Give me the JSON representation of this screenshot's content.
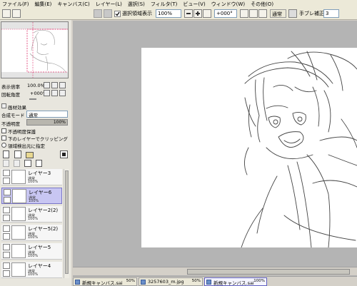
{
  "menu": [
    "ファイル(F)",
    "編集(E)",
    "キャンバス(C)",
    "レイヤー(L)",
    "選択(S)",
    "フィルタ(T)",
    "ビュー(V)",
    "ウィンドウ(W)",
    "その他(O)"
  ],
  "toolbar": {
    "selection_display_label": "選択領域表示",
    "zoom_value": "100%",
    "rotation_value": "+000°",
    "blend_value": "通常",
    "stabilizer_label": "手ブレ補正",
    "stabilizer_value": "3"
  },
  "navigator": {
    "zoom_label": "表示倍率",
    "zoom_value": "100.0%",
    "angle_label": "回転角度",
    "angle_value": "+000°"
  },
  "layer_props": {
    "paper_effect_label": "画材効果",
    "blend_mode_label": "合成モード",
    "blend_mode_value": "通常",
    "opacity_label": "不透明度",
    "opacity_value": "100%",
    "opacity_fraction": 1.0,
    "protect_alpha_label": "不透明度保護",
    "clip_label": "下のレイヤーでクリッピング",
    "selection_source_label": "領域検出元に指定"
  },
  "layers": [
    {
      "name": "レイヤー3",
      "mode": "通常",
      "opacity": "100%",
      "selected": false
    },
    {
      "name": "レイヤー6",
      "mode": "通常",
      "opacity": "100%",
      "selected": true
    },
    {
      "name": "レイヤー2(2)",
      "mode": "通常",
      "opacity": "100%",
      "selected": false
    },
    {
      "name": "レイヤー5(2)",
      "mode": "通常",
      "opacity": "100%",
      "selected": false
    },
    {
      "name": "レイヤー5",
      "mode": "通常",
      "opacity": "100%",
      "selected": false
    },
    {
      "name": "レイヤー4",
      "mode": "通常",
      "opacity": "100%",
      "selected": false
    }
  ],
  "tabs": [
    {
      "label": "新規キャンバス.sai",
      "zoom": "50%",
      "active": false
    },
    {
      "label": "3257603_m.jpg",
      "zoom": "50%",
      "active": false
    },
    {
      "label": "新規キャンバス.sai",
      "zoom": "100%",
      "active": true
    }
  ],
  "colors": {
    "accent": "#c8c6f2",
    "canvas_bg": "#b4b4b4",
    "panel_bg": "#e8e6de"
  }
}
